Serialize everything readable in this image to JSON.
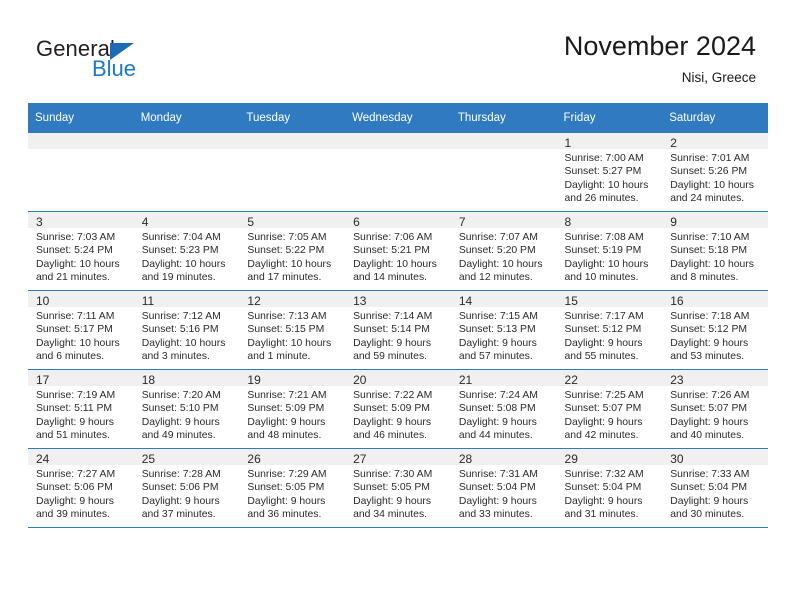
{
  "brand": {
    "name_part1": "General",
    "name_part2": "Blue",
    "triangle_icon": "triangle-icon",
    "accent_color": "#1b7ac6"
  },
  "header": {
    "title": "November 2024",
    "location": "Nisi, Greece"
  },
  "theme": {
    "header_blue": "#2f7ac0",
    "daynum_bg": "#f0f0f0",
    "text": "#2b2b2b"
  },
  "calendar": {
    "weekday_headers": [
      "Sunday",
      "Monday",
      "Tuesday",
      "Wednesday",
      "Thursday",
      "Friday",
      "Saturday"
    ],
    "labels": {
      "sunrise": "Sunrise:",
      "sunset": "Sunset:",
      "daylight": "Daylight:"
    },
    "weeks": [
      [
        {
          "day": "",
          "sunrise": "",
          "sunset": "",
          "daylight": ""
        },
        {
          "day": "",
          "sunrise": "",
          "sunset": "",
          "daylight": ""
        },
        {
          "day": "",
          "sunrise": "",
          "sunset": "",
          "daylight": ""
        },
        {
          "day": "",
          "sunrise": "",
          "sunset": "",
          "daylight": ""
        },
        {
          "day": "",
          "sunrise": "",
          "sunset": "",
          "daylight": ""
        },
        {
          "day": "1",
          "sunrise": "Sunrise: 7:00 AM",
          "sunset": "Sunset: 5:27 PM",
          "daylight": "Daylight: 10 hours and 26 minutes."
        },
        {
          "day": "2",
          "sunrise": "Sunrise: 7:01 AM",
          "sunset": "Sunset: 5:26 PM",
          "daylight": "Daylight: 10 hours and 24 minutes."
        }
      ],
      [
        {
          "day": "3",
          "sunrise": "Sunrise: 7:03 AM",
          "sunset": "Sunset: 5:24 PM",
          "daylight": "Daylight: 10 hours and 21 minutes."
        },
        {
          "day": "4",
          "sunrise": "Sunrise: 7:04 AM",
          "sunset": "Sunset: 5:23 PM",
          "daylight": "Daylight: 10 hours and 19 minutes."
        },
        {
          "day": "5",
          "sunrise": "Sunrise: 7:05 AM",
          "sunset": "Sunset: 5:22 PM",
          "daylight": "Daylight: 10 hours and 17 minutes."
        },
        {
          "day": "6",
          "sunrise": "Sunrise: 7:06 AM",
          "sunset": "Sunset: 5:21 PM",
          "daylight": "Daylight: 10 hours and 14 minutes."
        },
        {
          "day": "7",
          "sunrise": "Sunrise: 7:07 AM",
          "sunset": "Sunset: 5:20 PM",
          "daylight": "Daylight: 10 hours and 12 minutes."
        },
        {
          "day": "8",
          "sunrise": "Sunrise: 7:08 AM",
          "sunset": "Sunset: 5:19 PM",
          "daylight": "Daylight: 10 hours and 10 minutes."
        },
        {
          "day": "9",
          "sunrise": "Sunrise: 7:10 AM",
          "sunset": "Sunset: 5:18 PM",
          "daylight": "Daylight: 10 hours and 8 minutes."
        }
      ],
      [
        {
          "day": "10",
          "sunrise": "Sunrise: 7:11 AM",
          "sunset": "Sunset: 5:17 PM",
          "daylight": "Daylight: 10 hours and 6 minutes."
        },
        {
          "day": "11",
          "sunrise": "Sunrise: 7:12 AM",
          "sunset": "Sunset: 5:16 PM",
          "daylight": "Daylight: 10 hours and 3 minutes."
        },
        {
          "day": "12",
          "sunrise": "Sunrise: 7:13 AM",
          "sunset": "Sunset: 5:15 PM",
          "daylight": "Daylight: 10 hours and 1 minute."
        },
        {
          "day": "13",
          "sunrise": "Sunrise: 7:14 AM",
          "sunset": "Sunset: 5:14 PM",
          "daylight": "Daylight: 9 hours and 59 minutes."
        },
        {
          "day": "14",
          "sunrise": "Sunrise: 7:15 AM",
          "sunset": "Sunset: 5:13 PM",
          "daylight": "Daylight: 9 hours and 57 minutes."
        },
        {
          "day": "15",
          "sunrise": "Sunrise: 7:17 AM",
          "sunset": "Sunset: 5:12 PM",
          "daylight": "Daylight: 9 hours and 55 minutes."
        },
        {
          "day": "16",
          "sunrise": "Sunrise: 7:18 AM",
          "sunset": "Sunset: 5:12 PM",
          "daylight": "Daylight: 9 hours and 53 minutes."
        }
      ],
      [
        {
          "day": "17",
          "sunrise": "Sunrise: 7:19 AM",
          "sunset": "Sunset: 5:11 PM",
          "daylight": "Daylight: 9 hours and 51 minutes."
        },
        {
          "day": "18",
          "sunrise": "Sunrise: 7:20 AM",
          "sunset": "Sunset: 5:10 PM",
          "daylight": "Daylight: 9 hours and 49 minutes."
        },
        {
          "day": "19",
          "sunrise": "Sunrise: 7:21 AM",
          "sunset": "Sunset: 5:09 PM",
          "daylight": "Daylight: 9 hours and 48 minutes."
        },
        {
          "day": "20",
          "sunrise": "Sunrise: 7:22 AM",
          "sunset": "Sunset: 5:09 PM",
          "daylight": "Daylight: 9 hours and 46 minutes."
        },
        {
          "day": "21",
          "sunrise": "Sunrise: 7:24 AM",
          "sunset": "Sunset: 5:08 PM",
          "daylight": "Daylight: 9 hours and 44 minutes."
        },
        {
          "day": "22",
          "sunrise": "Sunrise: 7:25 AM",
          "sunset": "Sunset: 5:07 PM",
          "daylight": "Daylight: 9 hours and 42 minutes."
        },
        {
          "day": "23",
          "sunrise": "Sunrise: 7:26 AM",
          "sunset": "Sunset: 5:07 PM",
          "daylight": "Daylight: 9 hours and 40 minutes."
        }
      ],
      [
        {
          "day": "24",
          "sunrise": "Sunrise: 7:27 AM",
          "sunset": "Sunset: 5:06 PM",
          "daylight": "Daylight: 9 hours and 39 minutes."
        },
        {
          "day": "25",
          "sunrise": "Sunrise: 7:28 AM",
          "sunset": "Sunset: 5:06 PM",
          "daylight": "Daylight: 9 hours and 37 minutes."
        },
        {
          "day": "26",
          "sunrise": "Sunrise: 7:29 AM",
          "sunset": "Sunset: 5:05 PM",
          "daylight": "Daylight: 9 hours and 36 minutes."
        },
        {
          "day": "27",
          "sunrise": "Sunrise: 7:30 AM",
          "sunset": "Sunset: 5:05 PM",
          "daylight": "Daylight: 9 hours and 34 minutes."
        },
        {
          "day": "28",
          "sunrise": "Sunrise: 7:31 AM",
          "sunset": "Sunset: 5:04 PM",
          "daylight": "Daylight: 9 hours and 33 minutes."
        },
        {
          "day": "29",
          "sunrise": "Sunrise: 7:32 AM",
          "sunset": "Sunset: 5:04 PM",
          "daylight": "Daylight: 9 hours and 31 minutes."
        },
        {
          "day": "30",
          "sunrise": "Sunrise: 7:33 AM",
          "sunset": "Sunset: 5:04 PM",
          "daylight": "Daylight: 9 hours and 30 minutes."
        }
      ]
    ]
  }
}
